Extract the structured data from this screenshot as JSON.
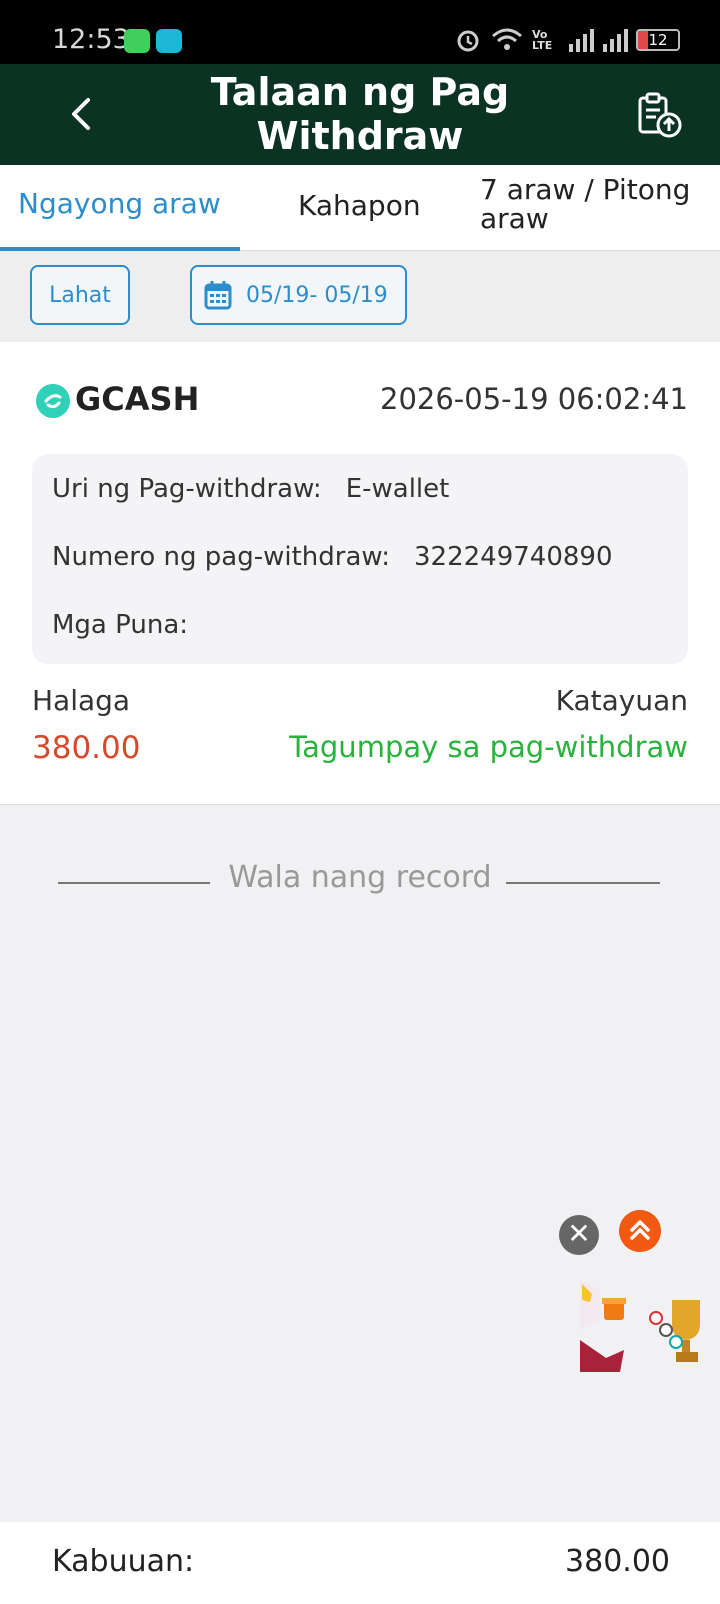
{
  "status_bar": {
    "time": "12:53",
    "network_label": "Vo LTE",
    "battery": "12"
  },
  "header": {
    "title": "Talaan ng Pag Withdraw",
    "background": "#0b3323"
  },
  "tabs": [
    {
      "label": "Ngayong araw",
      "active": true
    },
    {
      "label": "Kahapon",
      "active": false
    },
    {
      "label": "7 araw / Pitong araw",
      "active": false
    }
  ],
  "filters": {
    "all_label": "Lahat",
    "date_range": "05/19- 05/19"
  },
  "record": {
    "method": "GCASH",
    "datetime": "2026-05-19 06:02:41",
    "type_label": "Uri ng Pag-withdraw",
    "type_value": "E-wallet",
    "number_label": "Numero ng pag-withdraw",
    "number_value": "322249740890",
    "remarks_label": "Mga Puna",
    "remarks_value": "",
    "amount_label": "Halaga",
    "amount_value": "380.00",
    "status_label": "Katayuan",
    "status_value": "Tagumpay sa pag-withdraw"
  },
  "no_more": "Wala nang record",
  "footer": {
    "total_label": "Kabuuan:",
    "total_value": "380.00"
  },
  "colors": {
    "accent": "#2c8dcc",
    "amount": "#d44a2a",
    "success": "#28b33c"
  },
  "icons": {
    "back": "chevron-left-icon",
    "history": "clipboard-upload-icon",
    "calendar": "calendar-icon",
    "gcash": "gcash-logo-icon",
    "close": "close-icon",
    "scroll_top": "double-chevron-up-icon"
  }
}
